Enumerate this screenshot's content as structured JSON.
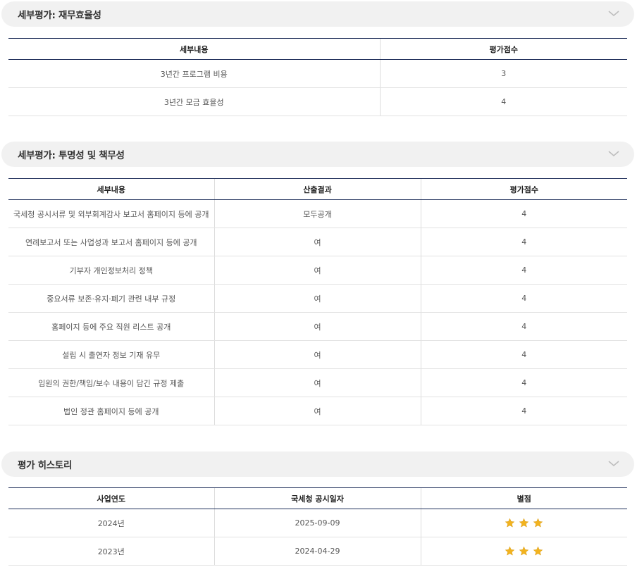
{
  "sections": [
    {
      "title": "세부평가: 재무효율성",
      "headers": [
        "세부내용",
        "평가점수"
      ],
      "rows": [
        [
          "3년간 프로그램 비용",
          "3"
        ],
        [
          "3년간 모금 효율성",
          "4"
        ]
      ]
    },
    {
      "title": "세부평가: 투명성 및 책무성",
      "headers": [
        "세부내용",
        "산출결과",
        "평가점수"
      ],
      "rows": [
        [
          "국세청 공시서류 및 외부회계감사 보고서 홈페이지 등에 공개",
          "모두공개",
          "4"
        ],
        [
          "연례보고서 또는 사업성과 보고서 홈페이지 등에 공개",
          "여",
          "4"
        ],
        [
          "기부자 개인정보처리 정책",
          "여",
          "4"
        ],
        [
          "중요서류 보존·유지·폐기 관련 내부 규정",
          "여",
          "4"
        ],
        [
          "홈페이지 등에 주요 직원 리스트 공개",
          "여",
          "4"
        ],
        [
          "설립 시 출연자 정보 기재 유무",
          "여",
          "4"
        ],
        [
          "임원의 권한/책임/보수 내용이 담긴 규정 제출",
          "여",
          "4"
        ],
        [
          "법인 정관 홈페이지 등에 공개",
          "여",
          "4"
        ]
      ]
    },
    {
      "title": "평가 히스토리",
      "headers": [
        "사업연도",
        "국세청 공시일자",
        "별점"
      ],
      "rows": [
        {
          "year": "2024년",
          "date": "2025-09-09",
          "stars": 3
        },
        {
          "year": "2023년",
          "date": "2024-04-29",
          "stars": 3
        }
      ]
    }
  ],
  "icons": {
    "collapse": "chevron-down-icon",
    "rating": "star-icon"
  },
  "colors": {
    "header_rule": "#1f2f5a",
    "star": "#f2b31f",
    "section_bg": "#f1f1f1"
  }
}
